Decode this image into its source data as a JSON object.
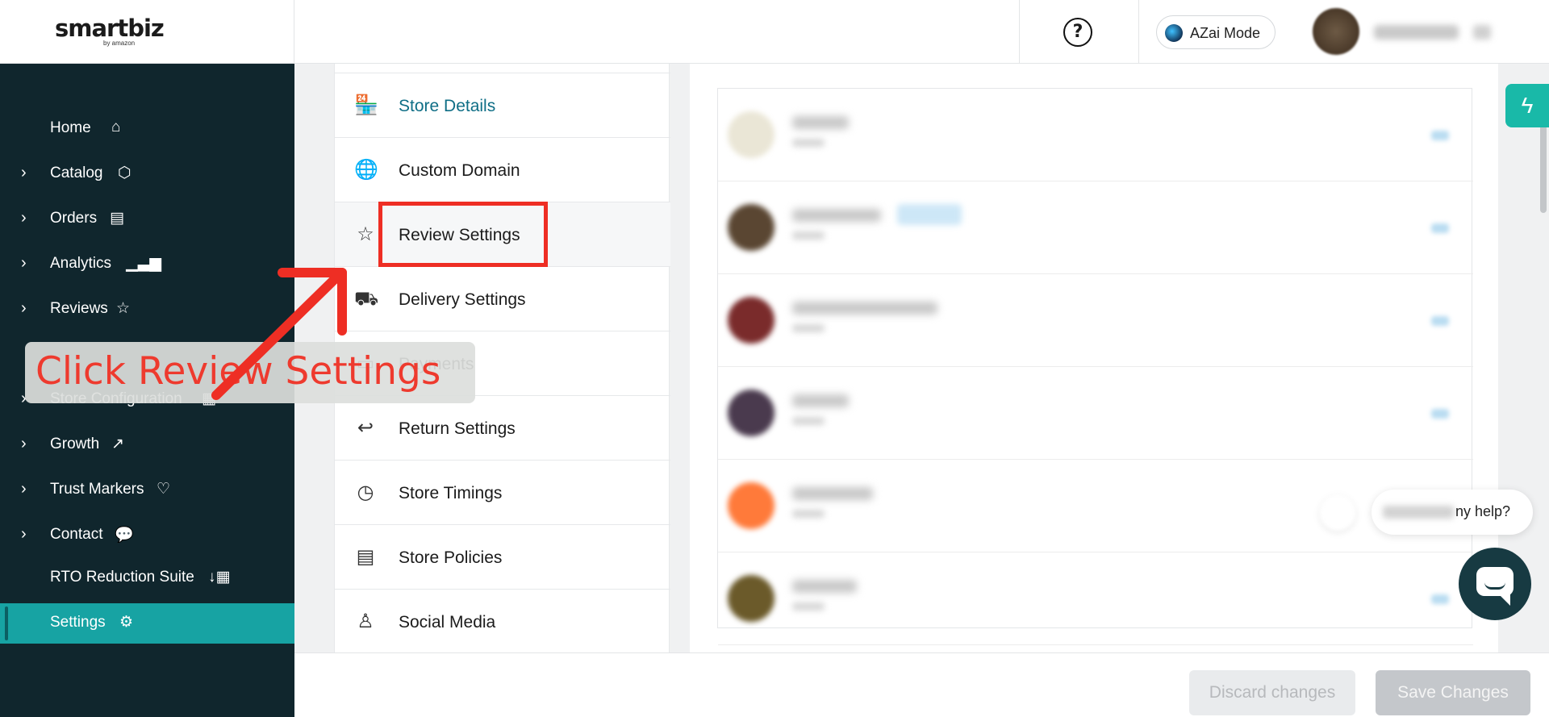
{
  "header": {
    "brand": "smartbiz",
    "brand_sub": "by amazon",
    "help_icon": "?",
    "azai_label": "AZai Mode"
  },
  "sidebar": {
    "items": [
      {
        "label": "Home",
        "icon": "home-icon",
        "glyph": "⌂",
        "chevron": false
      },
      {
        "label": "Catalog",
        "icon": "cube-icon",
        "glyph": "⬡",
        "chevron": true
      },
      {
        "label": "Orders",
        "icon": "clipboard-icon",
        "glyph": "▤",
        "chevron": true
      },
      {
        "label": "Analytics",
        "icon": "bar-chart-icon",
        "glyph": "▁▃▆",
        "chevron": true
      },
      {
        "label": "Reviews",
        "icon": "star-icon",
        "glyph": "☆",
        "chevron": true
      },
      {
        "label": "Store Configuration",
        "icon": "store-icon",
        "glyph": "▦",
        "chevron": true
      },
      {
        "label": "Growth",
        "icon": "trend-up-icon",
        "glyph": "↗",
        "chevron": true
      },
      {
        "label": "Trust Markers",
        "icon": "badge-heart-icon",
        "glyph": "♡",
        "chevron": true
      },
      {
        "label": "Contact",
        "icon": "chat-icon",
        "glyph": "💬",
        "chevron": true
      },
      {
        "label": "RTO Reduction Suite",
        "icon": "sort-icon",
        "glyph": "↓▦",
        "chevron": false
      },
      {
        "label": "Settings",
        "icon": "gear-icon",
        "glyph": "⚙",
        "chevron": false
      }
    ]
  },
  "settings_list": {
    "items": [
      {
        "label": "Store Details",
        "icon": "storefront-icon",
        "glyph": "🏪"
      },
      {
        "label": "Custom Domain",
        "icon": "globe-icon",
        "glyph": "🌐"
      },
      {
        "label": "Review Settings",
        "icon": "star-outline-icon",
        "glyph": "☆"
      },
      {
        "label": "Delivery Settings",
        "icon": "truck-icon",
        "glyph": "⛟"
      },
      {
        "label": "Payments",
        "icon": "card-icon",
        "glyph": "▭"
      },
      {
        "label": "Return Settings",
        "icon": "return-arrow-icon",
        "glyph": "↩"
      },
      {
        "label": "Store Timings",
        "icon": "clock-icon",
        "glyph": "◷"
      },
      {
        "label": "Store Policies",
        "icon": "document-icon",
        "glyph": "▤"
      },
      {
        "label": "Social Media",
        "icon": "user-heart-icon",
        "glyph": "♙"
      }
    ]
  },
  "footer": {
    "discard_label": "Discard changes",
    "save_label": "Save Changes"
  },
  "chat": {
    "prompt_visible": "ny help?"
  },
  "annotation": {
    "callout": "Click Review Settings"
  },
  "colors": {
    "sidebar_bg": "#10262d",
    "active_teal": "#17a3a3",
    "selected_link": "#0f6e86",
    "annotation_red": "#ee2e24"
  }
}
